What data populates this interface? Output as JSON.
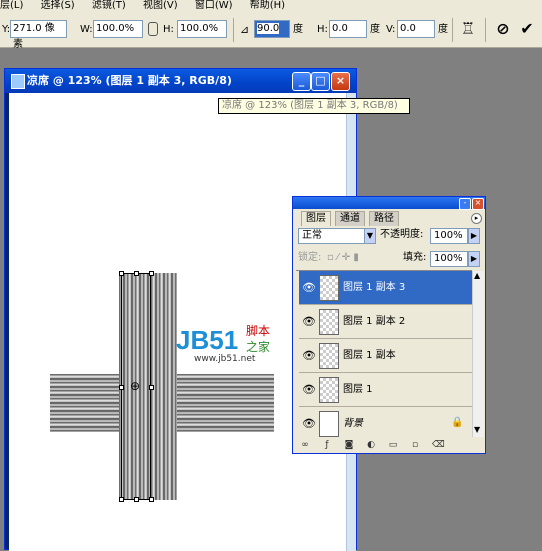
{
  "menu": {
    "items": [
      "层(L)",
      "选择(S)",
      "滤镜(T)",
      "视图(V)",
      "窗口(W)",
      "帮助(H)"
    ]
  },
  "options": {
    "y_label": "Y:",
    "y_value": "271.0 像素",
    "w_label": "W:",
    "w_value": "100.0%",
    "h_label": "H:",
    "h_value": "100.0%",
    "rot_value": "90.0",
    "rot_unit": "度",
    "hskew_label": "H:",
    "hskew_value": "0.0",
    "hskew_unit": "度",
    "vskew_label": "V:",
    "vskew_value": "0.0",
    "vskew_unit": "度",
    "cancel_icon": "cancel-icon",
    "commit_icon": "check-icon"
  },
  "document": {
    "title": "凉席 @ 123% (图层 1 副本 3, RGB/8)",
    "tooltip": "凉席 @ 123% (图层 1 副本 3, RGB/8)"
  },
  "watermark": {
    "logo": "JB51",
    "cn1": "脚本",
    "cn2": "之家",
    "url": "www.jb51.net"
  },
  "layers_panel": {
    "tabs": [
      "图层",
      "通道",
      "路径"
    ],
    "blend_mode": "正常",
    "opacity_label": "不透明度:",
    "opacity_value": "100%",
    "lock_label": "锁定:",
    "fill_label": "填充:",
    "fill_value": "100%",
    "layers": [
      {
        "name": "图层 1 副本 3",
        "active": true
      },
      {
        "name": "图层 1 副本 2",
        "active": false
      },
      {
        "name": "图层 1 副本",
        "active": false
      },
      {
        "name": "图层 1",
        "active": false
      },
      {
        "name": "背景",
        "active": false,
        "locked": true
      }
    ]
  },
  "colors": {
    "accent": "#316ac5",
    "titlebar": "#0a5ae0",
    "watermark_blue": "#1c8fd6",
    "watermark_red": "#cc0000",
    "watermark_green": "#2a8a2a"
  }
}
